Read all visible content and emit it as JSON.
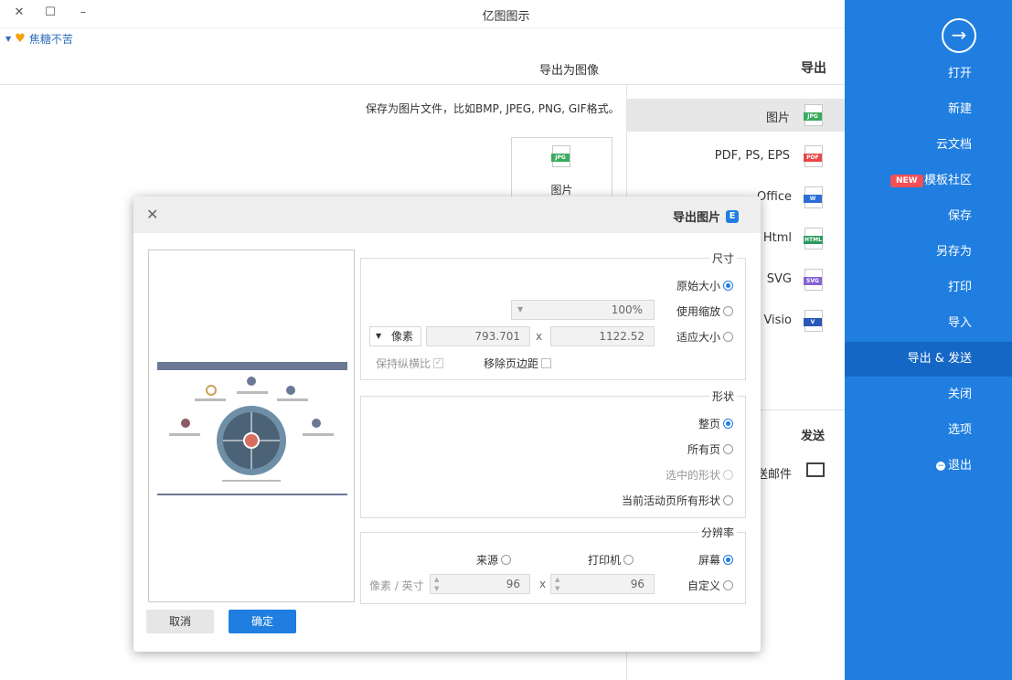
{
  "window": {
    "title": "亿图图示",
    "user": "焦糖不苦"
  },
  "sidebar": {
    "items": [
      {
        "label": "打开"
      },
      {
        "label": "新建"
      },
      {
        "label": "云文档"
      },
      {
        "label": "模板社区",
        "badge": "NEW"
      },
      {
        "label": "保存"
      },
      {
        "label": "另存为"
      },
      {
        "label": "打印"
      },
      {
        "label": "导入"
      },
      {
        "label": "导出 & 发送"
      },
      {
        "label": "关闭"
      },
      {
        "label": "选项"
      },
      {
        "label": "退出"
      }
    ]
  },
  "middle": {
    "export_title": "导出",
    "items": [
      {
        "label": "图片",
        "icon": "JPG"
      },
      {
        "label": "PDF, PS, EPS",
        "icon": "PDF"
      },
      {
        "label": "Office",
        "icon": "W"
      },
      {
        "label": "Html",
        "icon": "HTML"
      },
      {
        "label": "SVG",
        "icon": "SVG"
      },
      {
        "label": "Visio",
        "icon": "V"
      }
    ],
    "send_title": "发送",
    "send_item": "发送邮件"
  },
  "content": {
    "title": "导出为图像",
    "description": "保存为图片文件，比如BMP, JPEG, PNG, GIF格式。",
    "card_label": "图片",
    "card_icon": "JPG"
  },
  "dialog": {
    "title": "导出图片",
    "size": {
      "title": "尺寸",
      "original": "原始大小",
      "scale": "使用缩放",
      "scale_value": "100%",
      "fit": "适应大小",
      "width": "1122.52",
      "height": "793.701",
      "x": "x",
      "unit": "像素",
      "remove_margin": "移除页边距",
      "keep_ratio": "保持纵横比"
    },
    "shape": {
      "title": "形状",
      "whole": "整页",
      "all": "所有页",
      "selected": "选中的形状",
      "active_all": "当前活动页所有形状"
    },
    "resolution": {
      "title": "分辨率",
      "screen": "屏幕",
      "printer": "打印机",
      "source": "来源",
      "custom": "自定义",
      "dpi_x": "96",
      "dpi_y": "96",
      "x": "x",
      "unit": "像素 / 英寸"
    },
    "ok": "确定",
    "cancel": "取消"
  },
  "colors": {
    "accent": "#1f7ee0",
    "sidebar": "#1f7ee0",
    "badge": "#f44f54"
  }
}
